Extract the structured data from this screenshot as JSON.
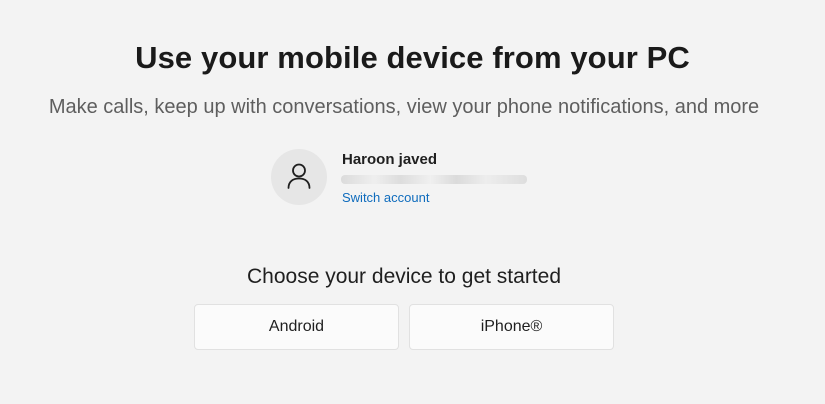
{
  "header": {
    "title": "Use your mobile device from your PC",
    "subtitle": "Make calls, keep up with conversations, view your phone notifications, and more"
  },
  "account": {
    "name": "Haroon javed",
    "avatar_icon": "person-icon",
    "switch_label": "Switch account"
  },
  "device_choice": {
    "heading": "Choose your device to get started",
    "options": [
      {
        "label": "Android"
      },
      {
        "label": "iPhone®"
      }
    ]
  },
  "colors": {
    "background": "#f3f3f3",
    "link": "#0f6cbd",
    "button_bg": "#fbfbfb"
  }
}
